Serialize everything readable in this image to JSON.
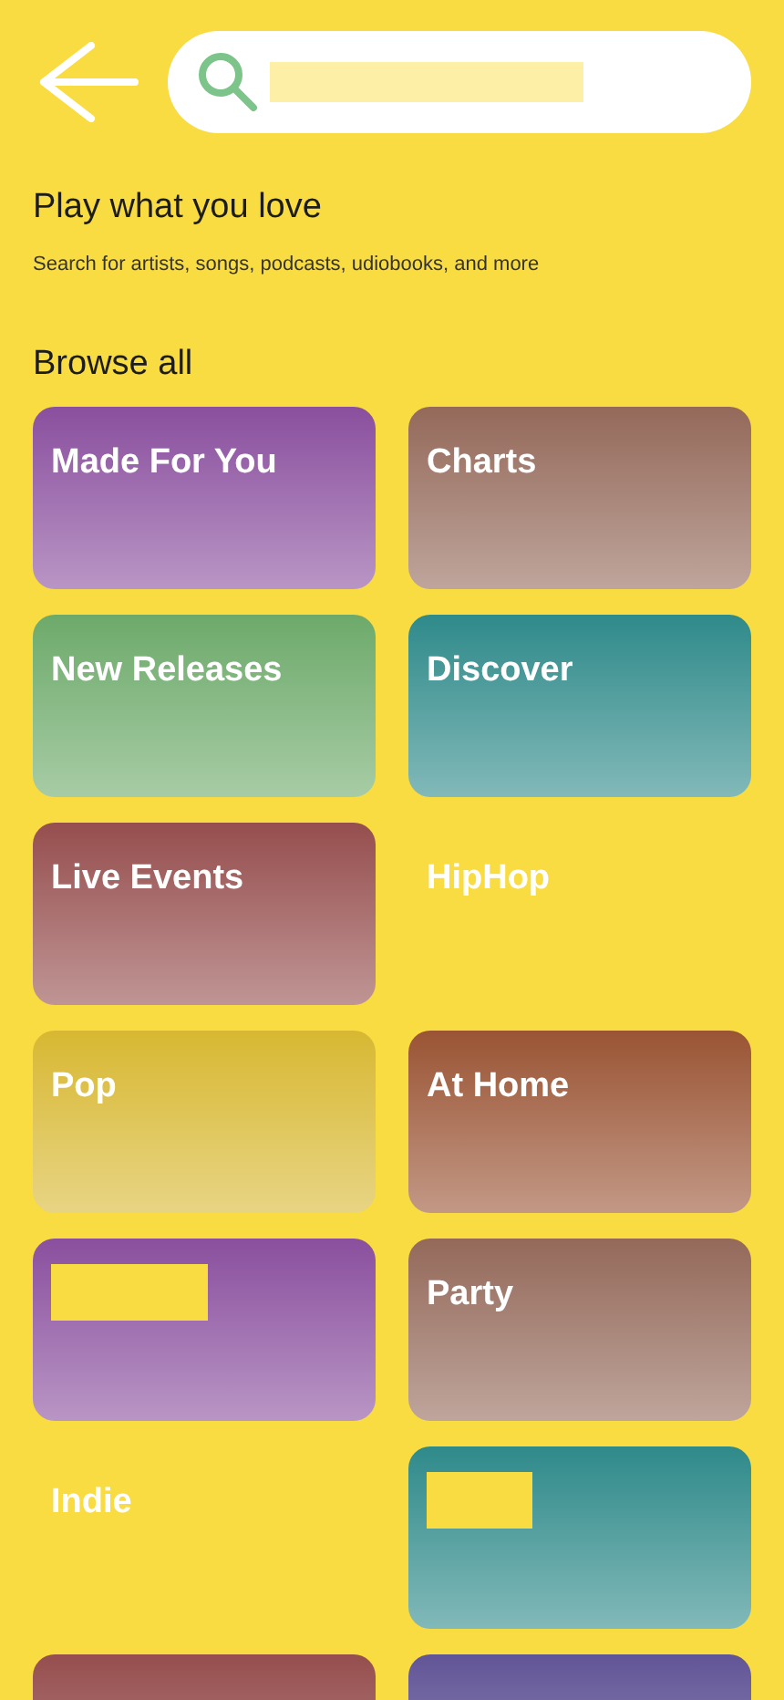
{
  "search": {
    "placeholder_hidden": true
  },
  "intro": {
    "title": "Play what you love",
    "subtitle": "Search for artists, songs, podcasts, udiobooks, and more"
  },
  "browse": {
    "title": "Browse all",
    "cards": [
      {
        "label": "Made For You",
        "color": "#8a4f9e"
      },
      {
        "label": "Charts",
        "color": "#94695a"
      },
      {
        "label": "New Releases",
        "color": "#6daa6a"
      },
      {
        "label": "Discover",
        "color": "#2f8a8a"
      },
      {
        "label": "Live Events",
        "color": "#964e4e"
      },
      {
        "label": "HipHop"
      },
      {
        "label": "Pop",
        "color": "#d8b832"
      },
      {
        "label": "At Home",
        "color": "#9a5434"
      },
      {
        "label_hidden": true,
        "color": "#8a4f9e"
      },
      {
        "label": "Party",
        "color": "#94695a"
      },
      {
        "label": "Indie"
      },
      {
        "label_hidden": true,
        "color": "#2f8a8a"
      },
      {
        "color": "#964e4e"
      },
      {
        "color": "#625597"
      }
    ]
  }
}
